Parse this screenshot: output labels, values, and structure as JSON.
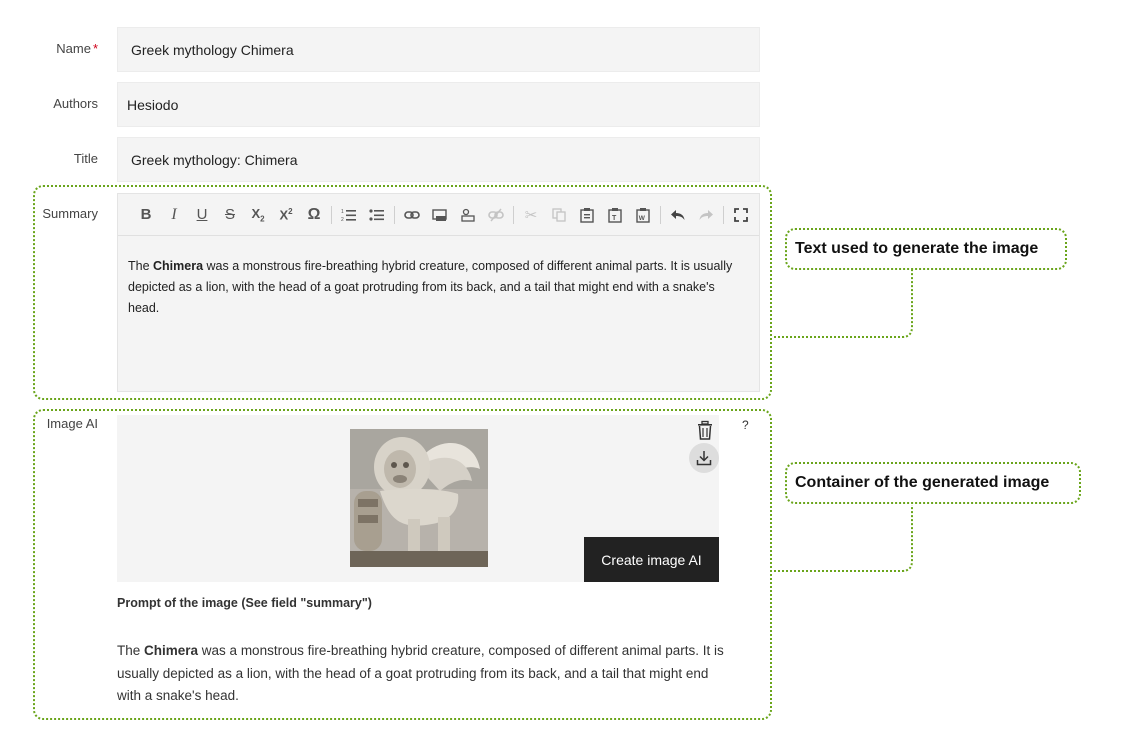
{
  "form": {
    "name": {
      "label": "Name",
      "required_mark": "*",
      "value": "Greek mythology Chimera"
    },
    "authors": {
      "label": "Authors",
      "value": "Hesiodo"
    },
    "title": {
      "label": "Title",
      "value": "Greek mythology: Chimera"
    },
    "summary": {
      "label": "Summary",
      "text": {
        "part1": "The ",
        "bold": "Chimera",
        "part2": " was a monstrous fire-breathing hybrid creature, composed of different animal parts. It is usually depicted as a lion, with the head of a goat protruding from its back, and a tail that might end with a snake's head."
      },
      "toolbar": [
        {
          "name": "bold",
          "glyph": "B"
        },
        {
          "name": "italic",
          "glyph": "I"
        },
        {
          "name": "underline",
          "glyph": "U"
        },
        {
          "name": "strikethrough",
          "glyph": "S"
        },
        {
          "name": "subscript",
          "glyph": "X₂"
        },
        {
          "name": "superscript",
          "glyph": "X²"
        },
        {
          "name": "special-char",
          "glyph": "Ω"
        },
        {
          "name": "numbered-list",
          "glyph": "1≡"
        },
        {
          "name": "bulleted-list",
          "glyph": "•≡"
        },
        {
          "name": "link",
          "glyph": "⛓"
        },
        {
          "name": "anchor",
          "glyph": "▭"
        },
        {
          "name": "image",
          "glyph": "▣"
        },
        {
          "name": "unlink",
          "glyph": "⛓",
          "disabled": true
        },
        {
          "name": "cut",
          "glyph": "✂",
          "disabled": true
        },
        {
          "name": "copy",
          "glyph": "⧉",
          "disabled": true
        },
        {
          "name": "paste",
          "glyph": "📋"
        },
        {
          "name": "paste-text",
          "glyph": "📋"
        },
        {
          "name": "paste-word",
          "glyph": "📋"
        },
        {
          "name": "undo",
          "glyph": "↶"
        },
        {
          "name": "redo",
          "glyph": "↷",
          "disabled": true
        },
        {
          "name": "maximize",
          "glyph": "⛶"
        }
      ]
    },
    "image_ai": {
      "label": "Image AI",
      "help": "?",
      "create_button": "Create image AI",
      "prompt_title": "Prompt of the image (See field \"summary\")",
      "prompt": {
        "part1": "The ",
        "bold": "Chimera",
        "part2": " was a monstrous fire-breathing hybrid creature, composed of different animal parts. It is usually depicted as a lion, with the head of a goat protruding from its back, and a tail that might end with a snake's head."
      }
    }
  },
  "callouts": {
    "summary": "Text used to generate the image",
    "image": "Container of the generated image"
  },
  "colors": {
    "accent": "#6aa51b",
    "button": "#222222",
    "field_bg": "#f4f4f4",
    "required": "#d0021b"
  }
}
